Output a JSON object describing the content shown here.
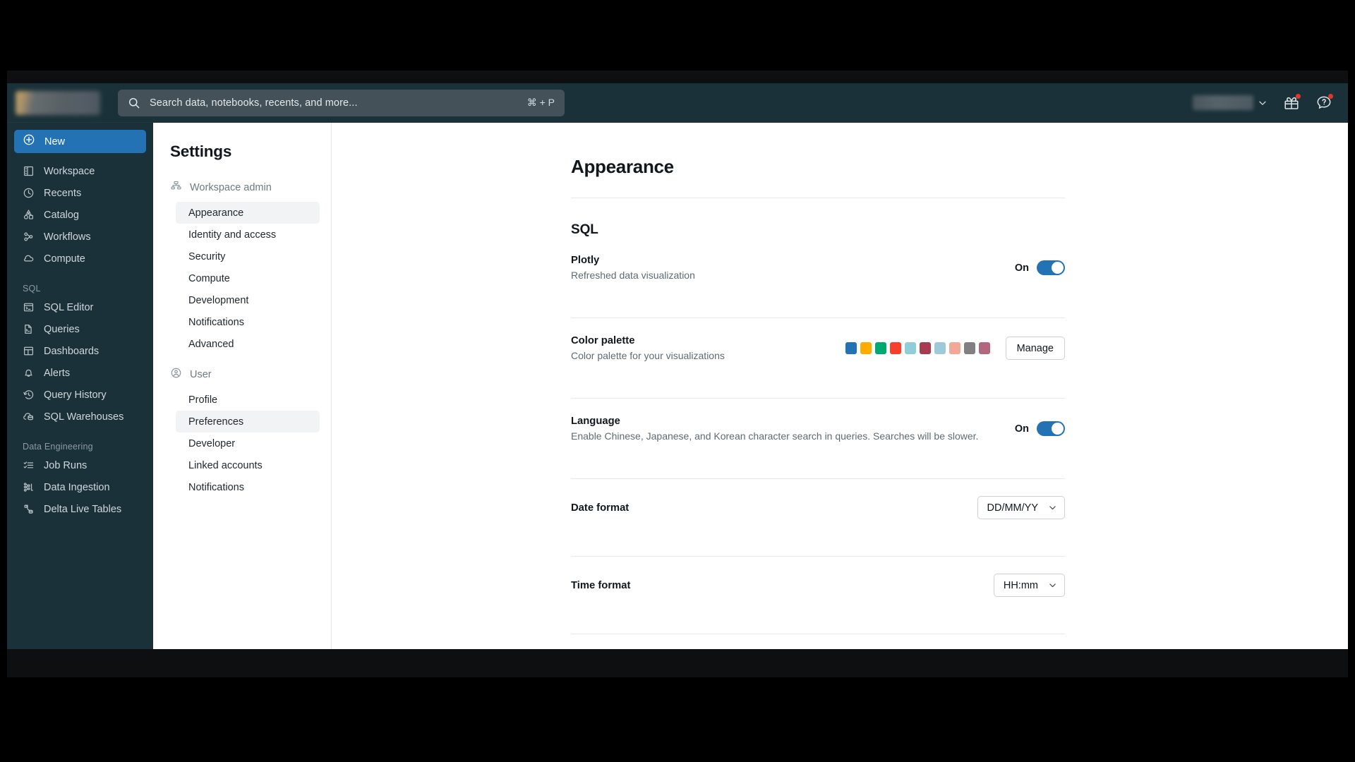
{
  "topbar": {
    "logo": "workspace-logo-redacted",
    "search": {
      "placeholder": "Search data, notebooks, recents, and more...",
      "shortcut": "⌘ + P",
      "icon": "search-icon"
    },
    "workspace_switcher": "workspace-name-redacted",
    "gift_icon": "gift-icon",
    "help_icon": "help-question-icon"
  },
  "sidebar": {
    "new_button": {
      "label": "New",
      "icon": "plus-circle-icon"
    },
    "items": [
      {
        "label": "Workspace",
        "icon": "workspace-icon"
      },
      {
        "label": "Recents",
        "icon": "clock-icon"
      },
      {
        "label": "Catalog",
        "icon": "catalog-icon"
      },
      {
        "label": "Workflows",
        "icon": "workflows-icon"
      },
      {
        "label": "Compute",
        "icon": "cloud-icon"
      }
    ],
    "group_sql": "SQL",
    "sql_items": [
      {
        "label": "SQL Editor",
        "icon": "sql-editor-icon"
      },
      {
        "label": "Queries",
        "icon": "queries-icon"
      },
      {
        "label": "Dashboards",
        "icon": "dashboards-icon"
      },
      {
        "label": "Alerts",
        "icon": "bell-icon"
      },
      {
        "label": "Query History",
        "icon": "history-icon"
      },
      {
        "label": "SQL Warehouses",
        "icon": "warehouse-icon"
      }
    ],
    "group_data_engineering": "Data Engineering",
    "de_items": [
      {
        "label": "Job Runs",
        "icon": "job-runs-icon"
      },
      {
        "label": "Data Ingestion",
        "icon": "data-ingestion-icon"
      },
      {
        "label": "Delta Live Tables",
        "icon": "delta-live-tables-icon"
      }
    ]
  },
  "settings_panel": {
    "title": "Settings",
    "groups": [
      {
        "label": "Workspace admin",
        "icon": "org-chart-icon",
        "links": [
          {
            "label": "Appearance",
            "active": true
          },
          {
            "label": "Identity and access",
            "active": false
          },
          {
            "label": "Security",
            "active": false
          },
          {
            "label": "Compute",
            "active": false
          },
          {
            "label": "Development",
            "active": false
          },
          {
            "label": "Notifications",
            "active": false
          },
          {
            "label": "Advanced",
            "active": false
          }
        ]
      },
      {
        "label": "User",
        "icon": "user-circle-icon",
        "links": [
          {
            "label": "Profile",
            "active": false
          },
          {
            "label": "Preferences",
            "active": true
          },
          {
            "label": "Developer",
            "active": false
          },
          {
            "label": "Linked accounts",
            "active": false
          },
          {
            "label": "Notifications",
            "active": false
          }
        ]
      }
    ]
  },
  "main": {
    "page_title": "Appearance",
    "section_title": "SQL",
    "plotly": {
      "title": "Plotly",
      "subtitle": "Refreshed data visualization",
      "toggle_state": "On",
      "toggle_on": true
    },
    "color_palette": {
      "title": "Color palette",
      "subtitle": "Color palette for your visualizations",
      "manage_label": "Manage",
      "colors": [
        "#2272b4",
        "#ffab00",
        "#00a972",
        "#f5402c",
        "#8ecdd9",
        "#a63a4e",
        "#9ec9d9",
        "#f3a897",
        "#808080",
        "#b2687c"
      ]
    },
    "language": {
      "title": "Language",
      "subtitle": "Enable Chinese, Japanese, and Korean character search in queries. Searches will be slower.",
      "toggle_state": "On",
      "toggle_on": true
    },
    "date_format": {
      "title": "Date format",
      "value": "DD/MM/YY"
    },
    "time_format": {
      "title": "Time format",
      "value": "HH:mm"
    }
  }
}
